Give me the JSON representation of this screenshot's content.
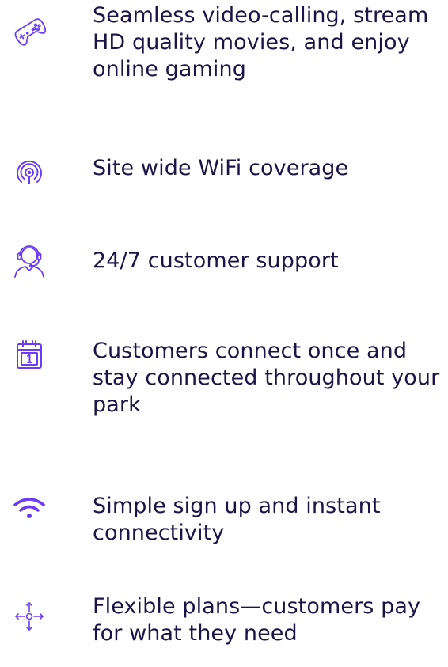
{
  "accent_color": "#6a3df5",
  "text_color": "#1b1446",
  "features": [
    {
      "icon": "gamepad-icon",
      "text": "Seamless video-calling, stream\nHD quality movies, and enjoy\nonline gaming"
    },
    {
      "icon": "wifi-signal-icon",
      "text": "Site wide WiFi coverage"
    },
    {
      "icon": "headset-support-icon",
      "text": "24/7 customer support"
    },
    {
      "icon": "calendar-icon",
      "text": "Customers connect once and\nstay connected throughout your\npark"
    },
    {
      "icon": "wifi-icon",
      "text": "Simple sign up and instant\nconnectivity"
    },
    {
      "icon": "move-arrows-icon",
      "text": "Flexible plans—customers pay\nfor what they need"
    }
  ]
}
